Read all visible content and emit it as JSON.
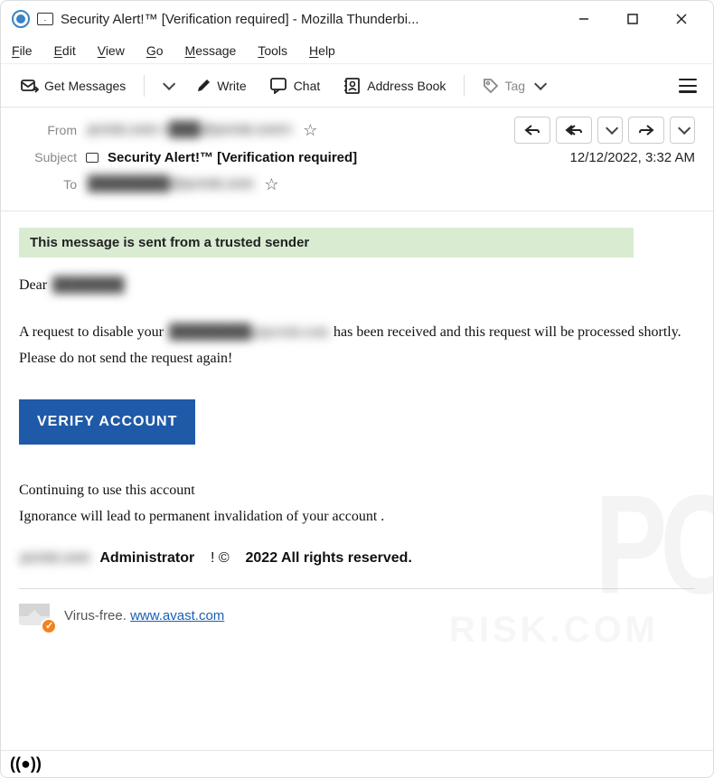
{
  "window": {
    "title": "Security Alert!™ [Verification required] - Mozilla Thunderbi..."
  },
  "menu": {
    "file": "File",
    "edit": "Edit",
    "view": "View",
    "go": "Go",
    "message": "Message",
    "tools": "Tools",
    "help": "Help"
  },
  "toolbar": {
    "get_messages": "Get Messages",
    "write": "Write",
    "chat": "Chat",
    "address_book": "Address Book",
    "tag": "Tag"
  },
  "headers": {
    "from_label": "From",
    "from_value": "pcrisk.com <███@pcrisk.com>",
    "subject_label": "Subject",
    "subject_value": "Security Alert!™ [Verification required]",
    "date": "12/12/2022, 3:32 AM",
    "to_label": "To",
    "to_value": "████████@pcrisk.com"
  },
  "body": {
    "trusted": "This message is sent from a trusted sender",
    "greeting_prefix": "Dear ",
    "greeting_name": "███████",
    "p1a": "A request to disable your ",
    "p1_blur": "████████@pcrisk.com",
    "p1b": " has been received and this request will be processed shortly.",
    "p2": "Please do not send the request again!",
    "verify": "VERIFY ACCOUNT",
    "p3": "Continuing to use this account",
    "p4": "Ignorance will lead to permanent invalidation of your account  .",
    "footer_blur": "pcrisk.com",
    "footer_admin": "Administrator",
    "footer_symbol": "! ©",
    "footer_rights": "2022 All rights reserved.",
    "av_text": "Virus-free.  ",
    "av_link": "www.avast.com"
  },
  "icons": {
    "minimize": "minimize",
    "maximize": "maximize",
    "close": "close"
  }
}
